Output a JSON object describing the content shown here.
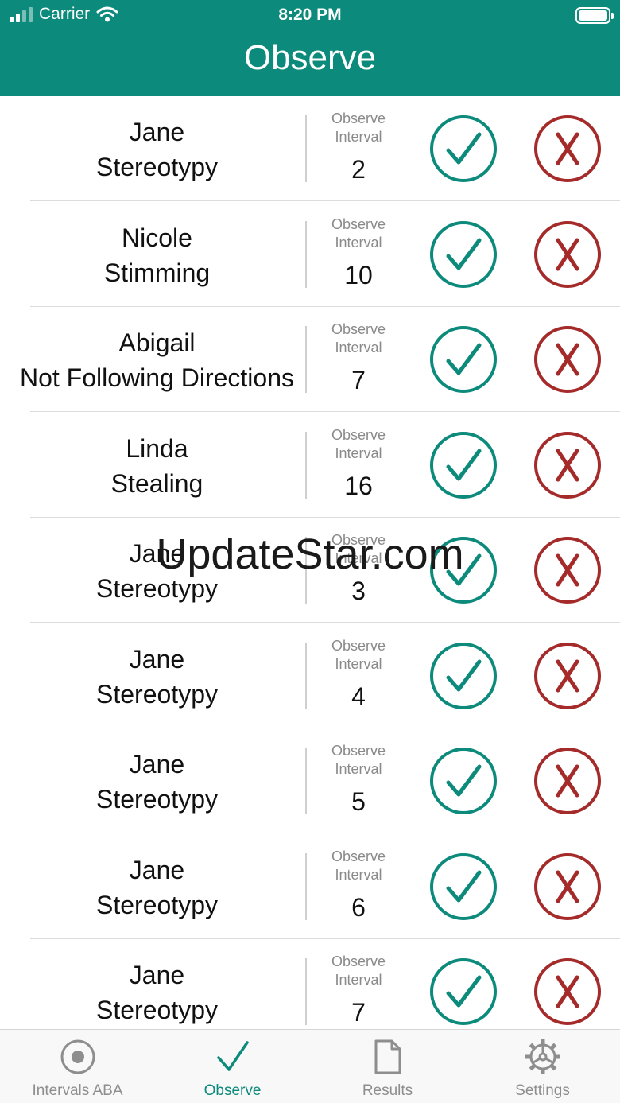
{
  "status_bar": {
    "carrier": "Carrier",
    "time": "8:20 PM"
  },
  "nav": {
    "title": "Observe"
  },
  "rows": [
    {
      "name": "Jane",
      "behavior": "Stereotypy",
      "interval_label": "Observe Interval",
      "interval": "2"
    },
    {
      "name": "Nicole",
      "behavior": "Stimming",
      "interval_label": "Observe Interval",
      "interval": "10"
    },
    {
      "name": "Abigail",
      "behavior": "Not Following Directions",
      "interval_label": "Observe Interval",
      "interval": "7"
    },
    {
      "name": "Linda",
      "behavior": "Stealing",
      "interval_label": "Observe Interval",
      "interval": "16"
    },
    {
      "name": "Jane",
      "behavior": "Stereotypy",
      "interval_label": "Observe Interval",
      "interval": "3"
    },
    {
      "name": "Jane",
      "behavior": "Stereotypy",
      "interval_label": "Observe Interval",
      "interval": "4"
    },
    {
      "name": "Jane",
      "behavior": "Stereotypy",
      "interval_label": "Observe Interval",
      "interval": "5"
    },
    {
      "name": "Jane",
      "behavior": "Stereotypy",
      "interval_label": "Observe Interval",
      "interval": "6"
    },
    {
      "name": "Jane",
      "behavior": "Stereotypy",
      "interval_label": "Observe Interval",
      "interval": "7"
    }
  ],
  "watermark": "UpdateStar.com",
  "tabs": [
    {
      "label": "Intervals ABA",
      "icon": "target-icon"
    },
    {
      "label": "Observe",
      "icon": "checkmark-icon",
      "active": true
    },
    {
      "label": "Results",
      "icon": "document-icon"
    },
    {
      "label": "Settings",
      "icon": "gear-icon"
    }
  ],
  "colors": {
    "primary": "#0c8a7b",
    "danger": "#a52a2a",
    "inactive": "#8e8e8e"
  }
}
